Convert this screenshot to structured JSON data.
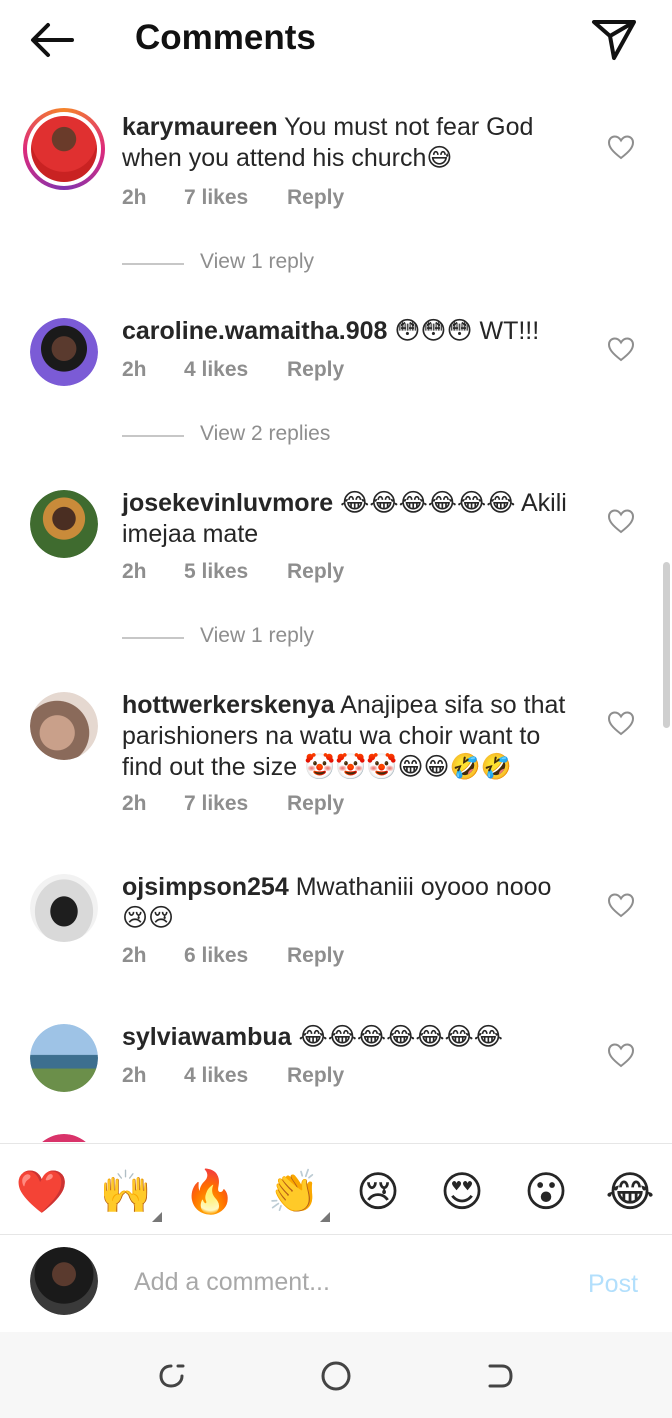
{
  "header": {
    "title": "Comments",
    "back_icon": "arrow-left-icon",
    "share_icon": "send-icon"
  },
  "comments": [
    {
      "username": "karymaureen",
      "text": "You must not fear God when you attend his church😅",
      "time": "2h",
      "likes": "7 likes",
      "reply": "Reply",
      "view_replies": "View 1 reply",
      "story_ring": true
    },
    {
      "username": "caroline.wamaitha.908",
      "text": "😳😳😳 WT!!!",
      "time": "2h",
      "likes": "4 likes",
      "reply": "Reply",
      "view_replies": "View 2 replies"
    },
    {
      "username": "josekevinluvmore",
      "text": "😂😂😂😂😂😂 Akili imejaa mate",
      "time": "2h",
      "likes": "5 likes",
      "reply": "Reply",
      "view_replies": "View 1 reply"
    },
    {
      "username": "hottwerkerskenya",
      "text": "Anajipea sifa so that parishioners na watu wa choir want to find out the size 🤡🤡🤡😁😁🤣🤣",
      "time": "2h",
      "likes": "7 likes",
      "reply": "Reply"
    },
    {
      "username": "ojsimpson254",
      "text": "Mwathaniii oyooo nooo 😢😢",
      "time": "2h",
      "likes": "6 likes",
      "reply": "Reply"
    },
    {
      "username": "sylviawambua",
      "text": "😂😂😂😂😂😂😂",
      "time": "2h",
      "likes": "4 likes",
      "reply": "Reply"
    }
  ],
  "reactions": [
    "❤️",
    "🙌",
    "🔥",
    "👏",
    "😢",
    "😍",
    "😮",
    "😂"
  ],
  "composer": {
    "placeholder": "Add a comment...",
    "post_label": "Post"
  },
  "colors": {
    "secondary_text": "#8e8e8e",
    "post_disabled": "#b2dffc",
    "story_ring": "#dd2a7b"
  }
}
